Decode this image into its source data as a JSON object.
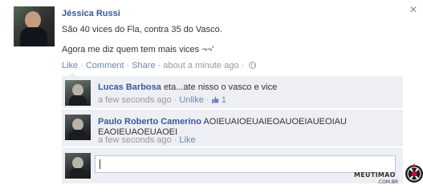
{
  "post": {
    "author": "Jéssica Russi",
    "text_lines": [
      "São 40 vices do Fla, contra 35 do Vasco.",
      "Agora me diz quem tem mais vices ¬¬'"
    ],
    "actions": {
      "like": "Like",
      "comment": "Comment",
      "share": "Share",
      "time": "about a minute ago",
      "separator": "·"
    },
    "close_icon": "close-icon",
    "privacy_icon": "globe-icon"
  },
  "comments": [
    {
      "author": "Lucas Barbosa",
      "text": "eta...ate nisso o vasco e vice",
      "time": "a few seconds ago",
      "action": "Unlike",
      "likes": "1"
    },
    {
      "author": "Paulo Roberto Camerino",
      "text": "AOIEUAIOEUAIEOAUOEIAUEOIAU EAOIEUAOEUAOEI",
      "time": "a few seconds ago",
      "action": "Like"
    },
    {
      "author": "",
      "text": "",
      "time": "",
      "action": ""
    }
  ],
  "reply": {
    "placeholder": "",
    "value": ""
  },
  "watermark": {
    "name": "MEUTIMAO",
    "domain": ".COM.BR"
  },
  "colors": {
    "link": "#3b5998",
    "muted_link": "#6d84b4",
    "comment_bg": "#edeff4"
  }
}
